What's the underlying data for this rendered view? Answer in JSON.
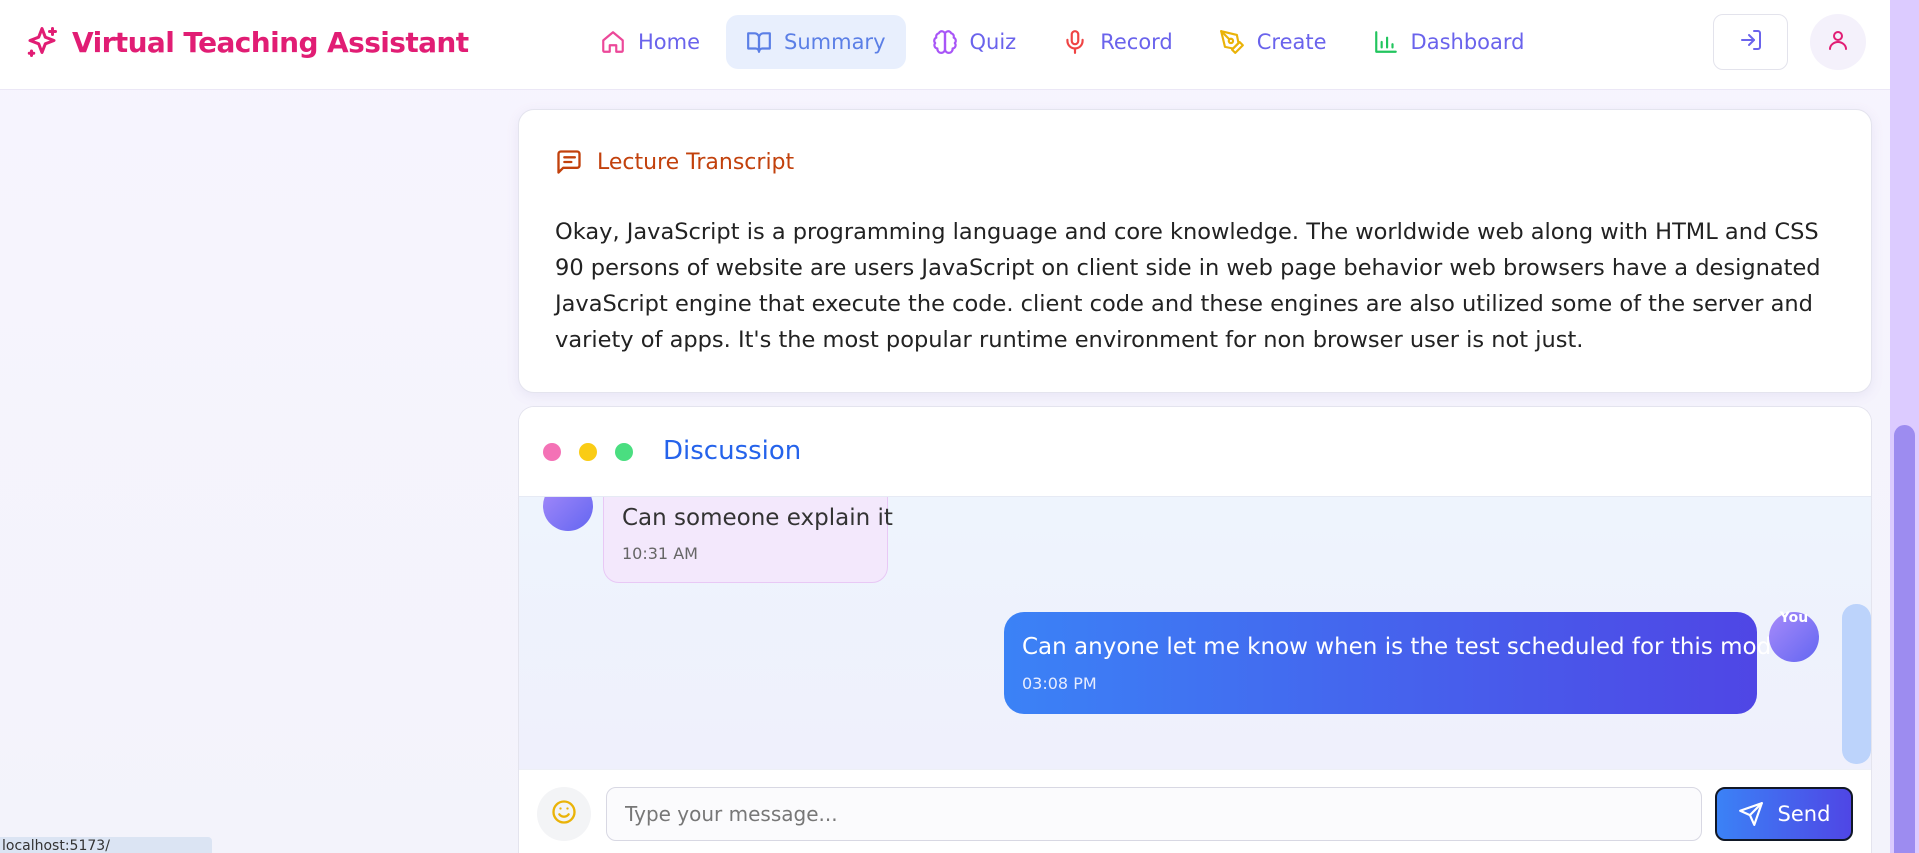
{
  "brand": {
    "title": "Virtual Teaching Assistant",
    "color": "#e11d74",
    "icon": "sparkles-icon"
  },
  "nav": {
    "items": [
      {
        "label": "Home",
        "icon": "home-icon",
        "icon_color": "#ec4899"
      },
      {
        "label": "Summary",
        "icon": "book-open-icon",
        "icon_color": "#5b7fe6",
        "active": true
      },
      {
        "label": "Quiz",
        "icon": "brain-icon",
        "icon_color": "#a855f7"
      },
      {
        "label": "Record",
        "icon": "microphone-icon",
        "icon_color": "#ef4444"
      },
      {
        "label": "Create",
        "icon": "pen-tool-icon",
        "icon_color": "#eab308"
      },
      {
        "label": "Dashboard",
        "icon": "bar-chart-icon",
        "icon_color": "#22c55e"
      }
    ],
    "label_color": "#6a63ec"
  },
  "header_actions": {
    "login_icon": "log-in-icon",
    "user_icon": "user-icon"
  },
  "transcript": {
    "title": "Lecture Transcript",
    "icon": "message-square-text-icon",
    "text": "Okay, JavaScript is a programming language and core knowledge. The worldwide web along with HTML and CSS 90 persons of website are users JavaScript on client side in web page behavior web browsers have a designated JavaScript engine that execute the code. client code and these engines are also utilized some of the server and variety of apps. It's the most popular runtime environment for non browser user is not just."
  },
  "discussion": {
    "title": "Discussion",
    "window_dots": [
      "#f472b6",
      "#facc15",
      "#4ade80"
    ],
    "messages": [
      {
        "text": "Can someone explain it",
        "time": "10:31 AM",
        "from": "other"
      },
      {
        "text": "Can anyone let me know when is the test scheduled for this module",
        "time": "03:08 PM",
        "from": "me",
        "avatar_label": "You"
      }
    ],
    "input": {
      "placeholder": "Type your message...",
      "value": ""
    },
    "emoji_icon": "smile-icon",
    "send_label": "Send",
    "send_icon": "send-icon"
  },
  "status_bar": {
    "text": "localhost:5173/"
  }
}
